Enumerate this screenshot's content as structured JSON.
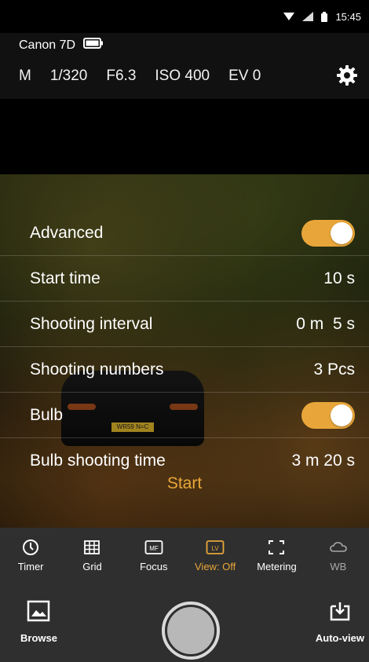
{
  "status": {
    "time": "15:45"
  },
  "camera": {
    "name": "Canon 7D",
    "mode": "M",
    "shutter": "1/320",
    "aperture": "F6.3",
    "iso": "ISO 400",
    "ev": "EV 0"
  },
  "preview": {
    "plate_text": "WR59 N=C"
  },
  "settings": {
    "advanced": {
      "label": "Advanced",
      "on": true
    },
    "start_time": {
      "label": "Start time",
      "value": "10 s"
    },
    "interval": {
      "label": "Shooting interval",
      "value": "0 m  5 s"
    },
    "numbers": {
      "label": "Shooting numbers",
      "value": "3 Pcs"
    },
    "bulb": {
      "label": "Bulb",
      "on": true
    },
    "bulb_time": {
      "label": "Bulb shooting time",
      "value": "3 m 20 s"
    }
  },
  "start_label": "Start",
  "tabs": [
    {
      "label": "Timer",
      "icon": "timer-icon"
    },
    {
      "label": "Grid",
      "icon": "grid-icon"
    },
    {
      "label": "Focus",
      "icon": "mf-icon"
    },
    {
      "label": "View: Off",
      "icon": "lv-icon"
    },
    {
      "label": "Metering",
      "icon": "metering-icon"
    },
    {
      "label": "WB",
      "icon": "cloud-icon"
    }
  ],
  "bottom": {
    "browse_label": "Browse",
    "autoview_label": "Auto-view"
  },
  "colors": {
    "accent": "#e8a63a",
    "toolbar": "#2f2f2f"
  }
}
